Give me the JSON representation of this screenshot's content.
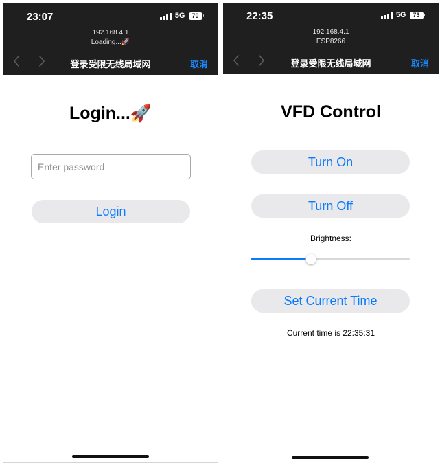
{
  "left": {
    "status": {
      "time": "23:07",
      "network": "5G",
      "battery": "70"
    },
    "address": "192.168.4.1",
    "subtitle": "Loading...🚀",
    "nav": {
      "title": "登录受限无线局域网",
      "cancel": "取消"
    },
    "heading": "Login...🚀",
    "password": {
      "value": "",
      "placeholder": "Enter password"
    },
    "login_button": "Login"
  },
  "right": {
    "status": {
      "time": "22:35",
      "network": "5G",
      "battery": "73"
    },
    "address": "192.168.4.1",
    "subtitle": "ESP8266",
    "nav": {
      "title": "登录受限无线局域网",
      "cancel": "取消"
    },
    "heading": "VFD Control",
    "turn_on": "Turn On",
    "turn_off": "Turn Off",
    "brightness": {
      "label": "Brightness:",
      "value": 0.38
    },
    "set_time": "Set Current Time",
    "current_time": "Current time is 22:35:31"
  },
  "colors": {
    "accent": "#0a7aff",
    "topbar": "#1f1f1f",
    "button_bg": "#e9e9eb"
  },
  "icons": [
    "signal-icon",
    "battery-icon",
    "chevron-left-icon",
    "chevron-right-icon"
  ]
}
